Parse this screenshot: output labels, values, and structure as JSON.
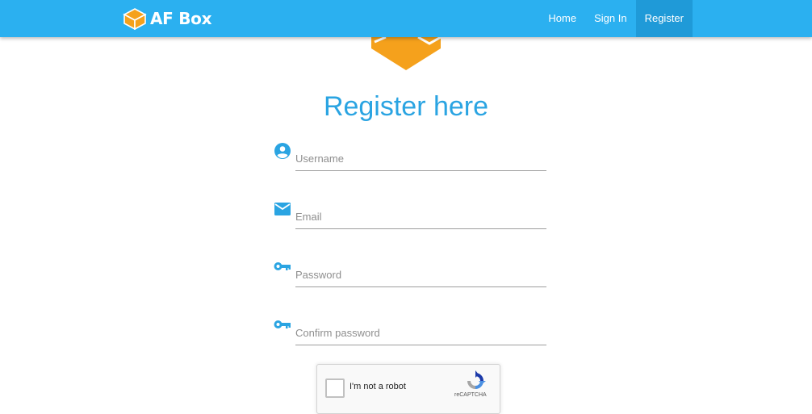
{
  "brand": {
    "name": "AF Box",
    "logo_icon": "box-logo-icon",
    "logo_color": "#f5a11c"
  },
  "nav": {
    "items": [
      {
        "label": "Home",
        "active": false
      },
      {
        "label": "Sign In",
        "active": false
      },
      {
        "label": "Register",
        "active": true
      }
    ]
  },
  "page": {
    "title": "Register here"
  },
  "form": {
    "username": {
      "placeholder": "Username",
      "icon": "account-circle-icon"
    },
    "email": {
      "placeholder": "Email",
      "icon": "email-icon"
    },
    "password": {
      "placeholder": "Password",
      "icon": "key-icon"
    },
    "confirm_password": {
      "placeholder": "Confirm password",
      "icon": "key-icon"
    }
  },
  "recaptcha": {
    "label": "I'm not a robot",
    "brand": "reCAPTCHA"
  },
  "colors": {
    "navbar": "#2bb0f0",
    "nav_active": "#1f9ad8",
    "accent": "#2aa4e2",
    "logo_orange": "#f5a11c"
  }
}
